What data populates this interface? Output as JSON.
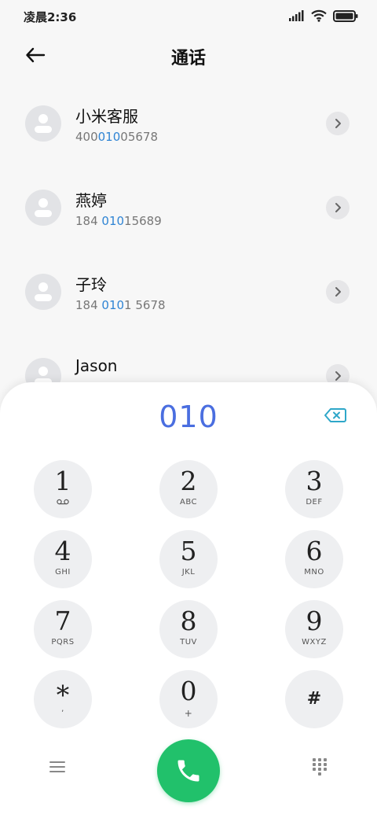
{
  "status_bar": {
    "time": "凌晨2:36",
    "icons": [
      "signal-icon",
      "wifi-icon",
      "battery-icon"
    ]
  },
  "header": {
    "title": "通话",
    "back_icon": "arrow-left-icon"
  },
  "contacts": [
    {
      "name": "小米客服",
      "number_parts": [
        [
          "400",
          false
        ],
        [
          "010",
          true
        ],
        [
          "05678",
          false
        ]
      ],
      "action_icon": "chevron-right-icon"
    },
    {
      "name": "燕婷",
      "number_parts": [
        [
          "184 ",
          false
        ],
        [
          "010",
          true
        ],
        [
          "15689",
          false
        ]
      ],
      "action_icon": "chevron-right-icon"
    },
    {
      "name": "子玲",
      "number_parts": [
        [
          "184 ",
          false
        ],
        [
          "010",
          true
        ],
        [
          "1 5678",
          false
        ]
      ],
      "action_icon": "chevron-right-icon"
    },
    {
      "name": "Jason",
      "number_parts": [],
      "action_icon": "chevron-right-icon"
    }
  ],
  "dialer": {
    "dialed_number": "010",
    "backspace_icon": "backspace-icon",
    "keys": [
      {
        "digit": "1",
        "letters": "",
        "icon": "voicemail-icon"
      },
      {
        "digit": "2",
        "letters": "ABC"
      },
      {
        "digit": "3",
        "letters": "DEF"
      },
      {
        "digit": "4",
        "letters": "GHI"
      },
      {
        "digit": "5",
        "letters": "JKL"
      },
      {
        "digit": "6",
        "letters": "MNO"
      },
      {
        "digit": "7",
        "letters": "PQRS"
      },
      {
        "digit": "8",
        "letters": "TUV"
      },
      {
        "digit": "9",
        "letters": "WXYZ"
      },
      {
        "digit": "*",
        "letters": ","
      },
      {
        "digit": "0",
        "letters": "+"
      },
      {
        "digit": "#",
        "letters": ""
      }
    ]
  },
  "bottom_bar": {
    "menu_icon": "menu-icon",
    "call_icon": "phone-icon",
    "keypad_icon": "dialpad-icon"
  },
  "colors": {
    "accent_blue": "#2f84d4",
    "dialed_blue": "#4a6ee0",
    "call_green": "#21c16b",
    "backspace_teal": "#2ea7c9"
  }
}
